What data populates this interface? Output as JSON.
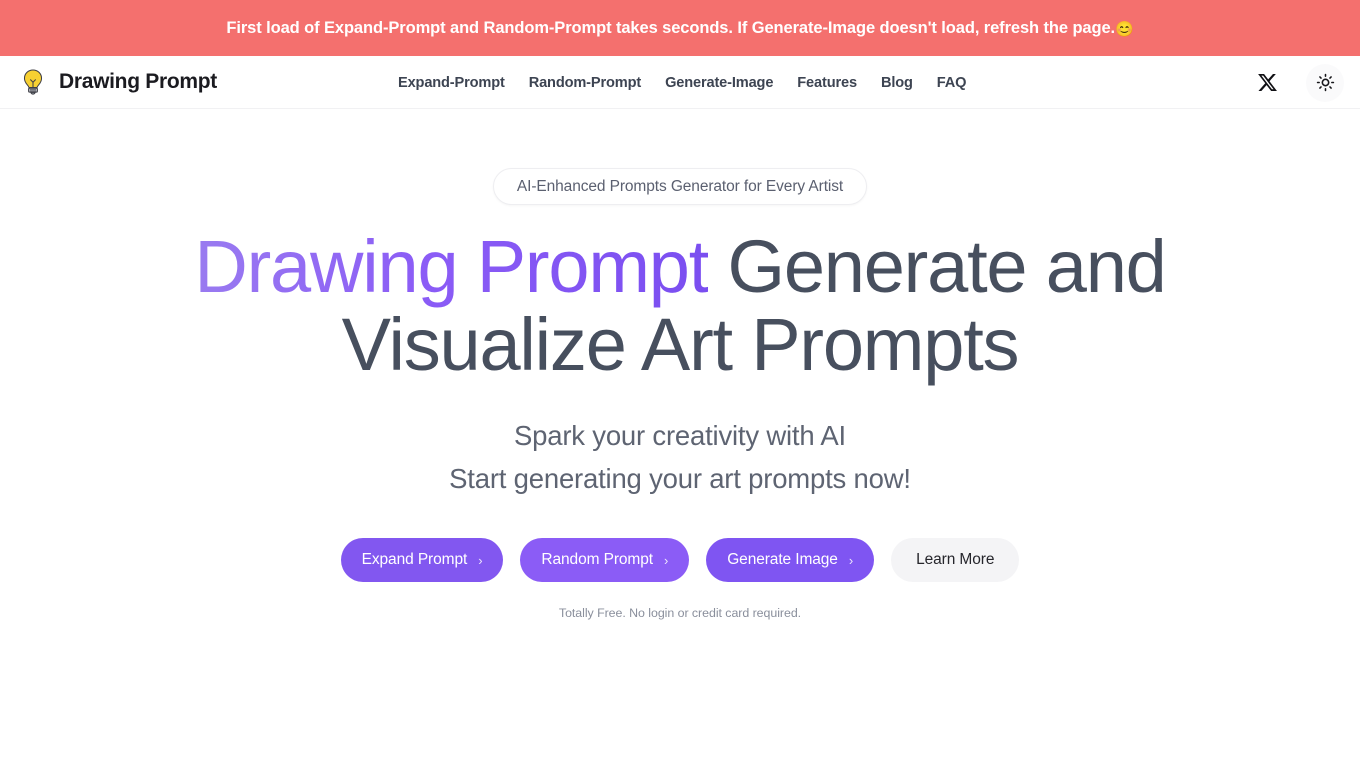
{
  "announcement": {
    "text": "First load of Expand-Prompt and Random-Prompt takes seconds. If Generate-Image doesn't load, refresh the page.",
    "emoji": "😊",
    "background_color": "#f4706e",
    "text_color": "#ffffff"
  },
  "header": {
    "brand_name": "Drawing Prompt",
    "logo_icon": "lightbulb-icon",
    "nav": [
      {
        "label": "Expand-Prompt"
      },
      {
        "label": "Random-Prompt"
      },
      {
        "label": "Generate-Image"
      },
      {
        "label": "Features"
      },
      {
        "label": "Blog"
      },
      {
        "label": "FAQ"
      }
    ],
    "actions": [
      {
        "name": "x-twitter-icon",
        "label": "X"
      },
      {
        "name": "sun-icon",
        "label": "Light mode"
      }
    ]
  },
  "hero": {
    "badge": "AI-Enhanced Prompts Generator for Every Artist",
    "title_accent": "Drawing Prompt",
    "title_rest": "Generate and Visualize Art Prompts",
    "subtitle_line1": "Spark your creativity with AI",
    "subtitle_line2": "Start generating your art prompts now!",
    "fineprint": "Totally Free. No login or credit card required.",
    "accent_color": "#8b5cf6",
    "buttons": [
      {
        "label": "Expand Prompt",
        "chevron": "›",
        "style": "primary"
      },
      {
        "label": "Random Prompt",
        "chevron": "›",
        "style": "primary"
      },
      {
        "label": "Generate Image",
        "chevron": "›",
        "style": "primary"
      },
      {
        "label": "Learn More",
        "chevron": "",
        "style": "ghost"
      }
    ]
  }
}
